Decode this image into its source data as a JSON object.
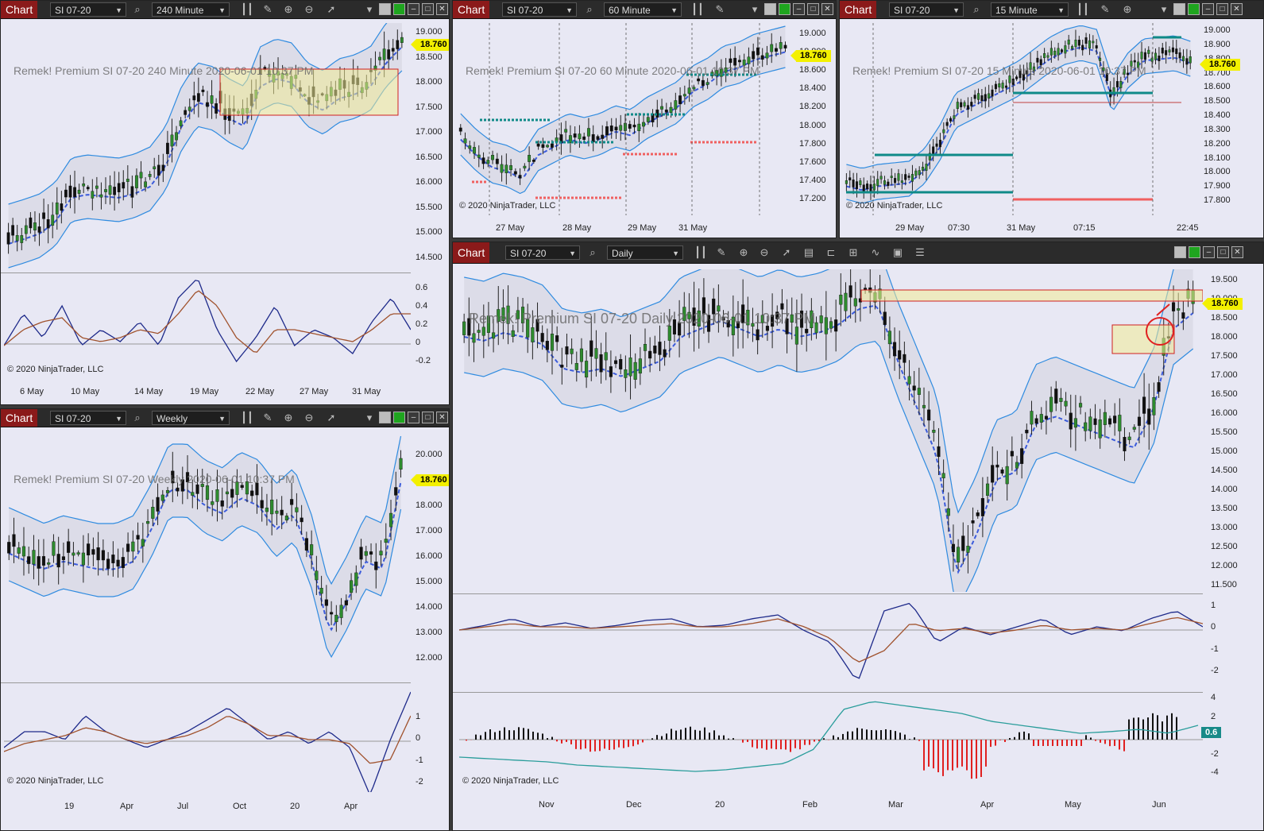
{
  "toolbar": {
    "chart_label": "Chart"
  },
  "windows": {
    "m240": {
      "instrument": "SI 07-20",
      "timeframe": "240 Minute",
      "watermark": "Remek!  Premium  SI 07-20  240 Minute  2020-06-01 10:37 PM",
      "price": "18.760",
      "price_axis": [
        "19.000",
        "18.500",
        "18.000",
        "17.500",
        "17.000",
        "16.500",
        "16.000",
        "15.500",
        "15.000",
        "14.500"
      ],
      "osc_axis": [
        "0.6",
        "0.4",
        "0.2",
        "0",
        "-0.2"
      ],
      "time_axis": [
        "6 May",
        "10 May",
        "14 May",
        "19 May",
        "22 May",
        "27 May",
        "31 May"
      ],
      "copyright": "© 2020 NinjaTrader, LLC"
    },
    "m60": {
      "instrument": "SI 07-20",
      "timeframe": "60 Minute",
      "watermark": "Remek!  Premium  SI 07-20  60 Minute  2020-06-01 10:37 PM",
      "price": "18.760",
      "price_axis": [
        "19.000",
        "18.800",
        "18.600",
        "18.400",
        "18.200",
        "18.000",
        "17.800",
        "17.600",
        "17.400",
        "17.200"
      ],
      "time_axis": [
        "27 May",
        "28 May",
        "29 May",
        "31 May"
      ],
      "copyright": "© 2020 NinjaTrader, LLC"
    },
    "m15": {
      "instrument": "SI 07-20",
      "timeframe": "15 Minute",
      "watermark": "Remek!  Premium  SI 07-20  15 Minute  2020-06-01 10:37 PM",
      "price": "18.760",
      "price_axis": [
        "19.000",
        "18.900",
        "18.800",
        "18.700",
        "18.600",
        "18.500",
        "18.400",
        "18.300",
        "18.200",
        "18.100",
        "18.000",
        "17.900",
        "17.800"
      ],
      "time_axis": [
        "29 May",
        "07:30",
        "31 May",
        "07:15",
        "22:45"
      ],
      "copyright": "© 2020 NinjaTrader, LLC"
    },
    "weekly": {
      "instrument": "SI 07-20",
      "timeframe": "Weekly",
      "watermark": "Remek!  Premium  SI 07-20  Weekly  2020-06-01 10:37 PM",
      "price": "18.760",
      "price_axis": [
        "20.000",
        "19.000",
        "18.000",
        "17.000",
        "16.000",
        "15.000",
        "14.000",
        "13.000",
        "12.000"
      ],
      "osc_axis": [
        "1",
        "0",
        "-1",
        "-2"
      ],
      "time_axis": [
        "19",
        "Apr",
        "Jul",
        "Oct",
        "20",
        "Apr"
      ],
      "copyright": "© 2020 NinjaTrader, LLC"
    },
    "daily": {
      "instrument": "SI 07-20",
      "timeframe": "Daily",
      "watermark": "Remek!  Premium  SI 07-20  Daily  2020-06-01 10:37 PM",
      "price": "18.760",
      "price_axis": [
        "19.500",
        "19.000",
        "18.500",
        "18.000",
        "17.500",
        "17.000",
        "16.500",
        "16.000",
        "15.500",
        "15.000",
        "14.500",
        "14.000",
        "13.500",
        "13.000",
        "12.500",
        "12.000",
        "11.500"
      ],
      "osc_axis": [
        "1",
        "0",
        "-1",
        "-2"
      ],
      "hist_axis": [
        "4",
        "2",
        "0",
        "-2",
        "-4"
      ],
      "hist_value": "0.6",
      "time_axis": [
        "Nov",
        "Dec",
        "20",
        "Feb",
        "Mar",
        "Apr",
        "May",
        "Jun"
      ],
      "copyright": "© 2020 NinjaTrader, LLC"
    }
  },
  "icons": [
    "search-icon",
    "bar-style-icon",
    "draw-pencil-icon",
    "zoom-in-icon",
    "zoom-out-icon",
    "cursor-icon",
    "dropdown-icon",
    "window-minimize-icon",
    "window-maximize-icon",
    "window-close-icon"
  ],
  "colors": {
    "accent_red": "#8b1a1a",
    "price_tag": "#f3f000",
    "band_blue": "#2f8be0",
    "ma_blue": "#3b5bdb",
    "ma_red": "#e0263a",
    "ma_yellow": "#f2f200",
    "teal": "#118a88"
  }
}
